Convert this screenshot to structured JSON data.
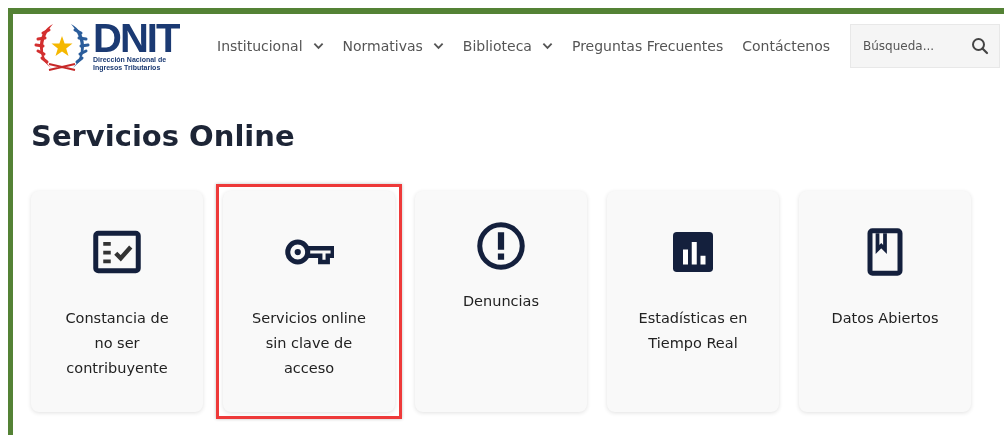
{
  "logo": {
    "name": "DNIT",
    "subtitle": "Dirección Nacional de\nIngresos Tributarios"
  },
  "nav": [
    {
      "label": "Institucional",
      "dropdown": true
    },
    {
      "label": "Normativas",
      "dropdown": true
    },
    {
      "label": "Biblioteca",
      "dropdown": true
    },
    {
      "label": "Preguntas Frecuentes",
      "dropdown": false
    },
    {
      "label": "Contáctenos",
      "dropdown": false
    }
  ],
  "search": {
    "placeholder": "Búsqueda..."
  },
  "heading": "Servicios Online",
  "services": [
    {
      "kind": "checklist",
      "label": "Constancia de\nno ser\ncontribuyente",
      "highlighted": false
    },
    {
      "kind": "key",
      "label": "Servicios online\nsin clave de\nacceso",
      "highlighted": true
    },
    {
      "kind": "alert",
      "label": "Denuncias",
      "highlighted": false
    },
    {
      "kind": "chart",
      "label": "Estadísticas en\nTiempo Real",
      "highlighted": false
    },
    {
      "kind": "book",
      "label": "Datos Abiertos",
      "highlighted": false
    }
  ]
}
